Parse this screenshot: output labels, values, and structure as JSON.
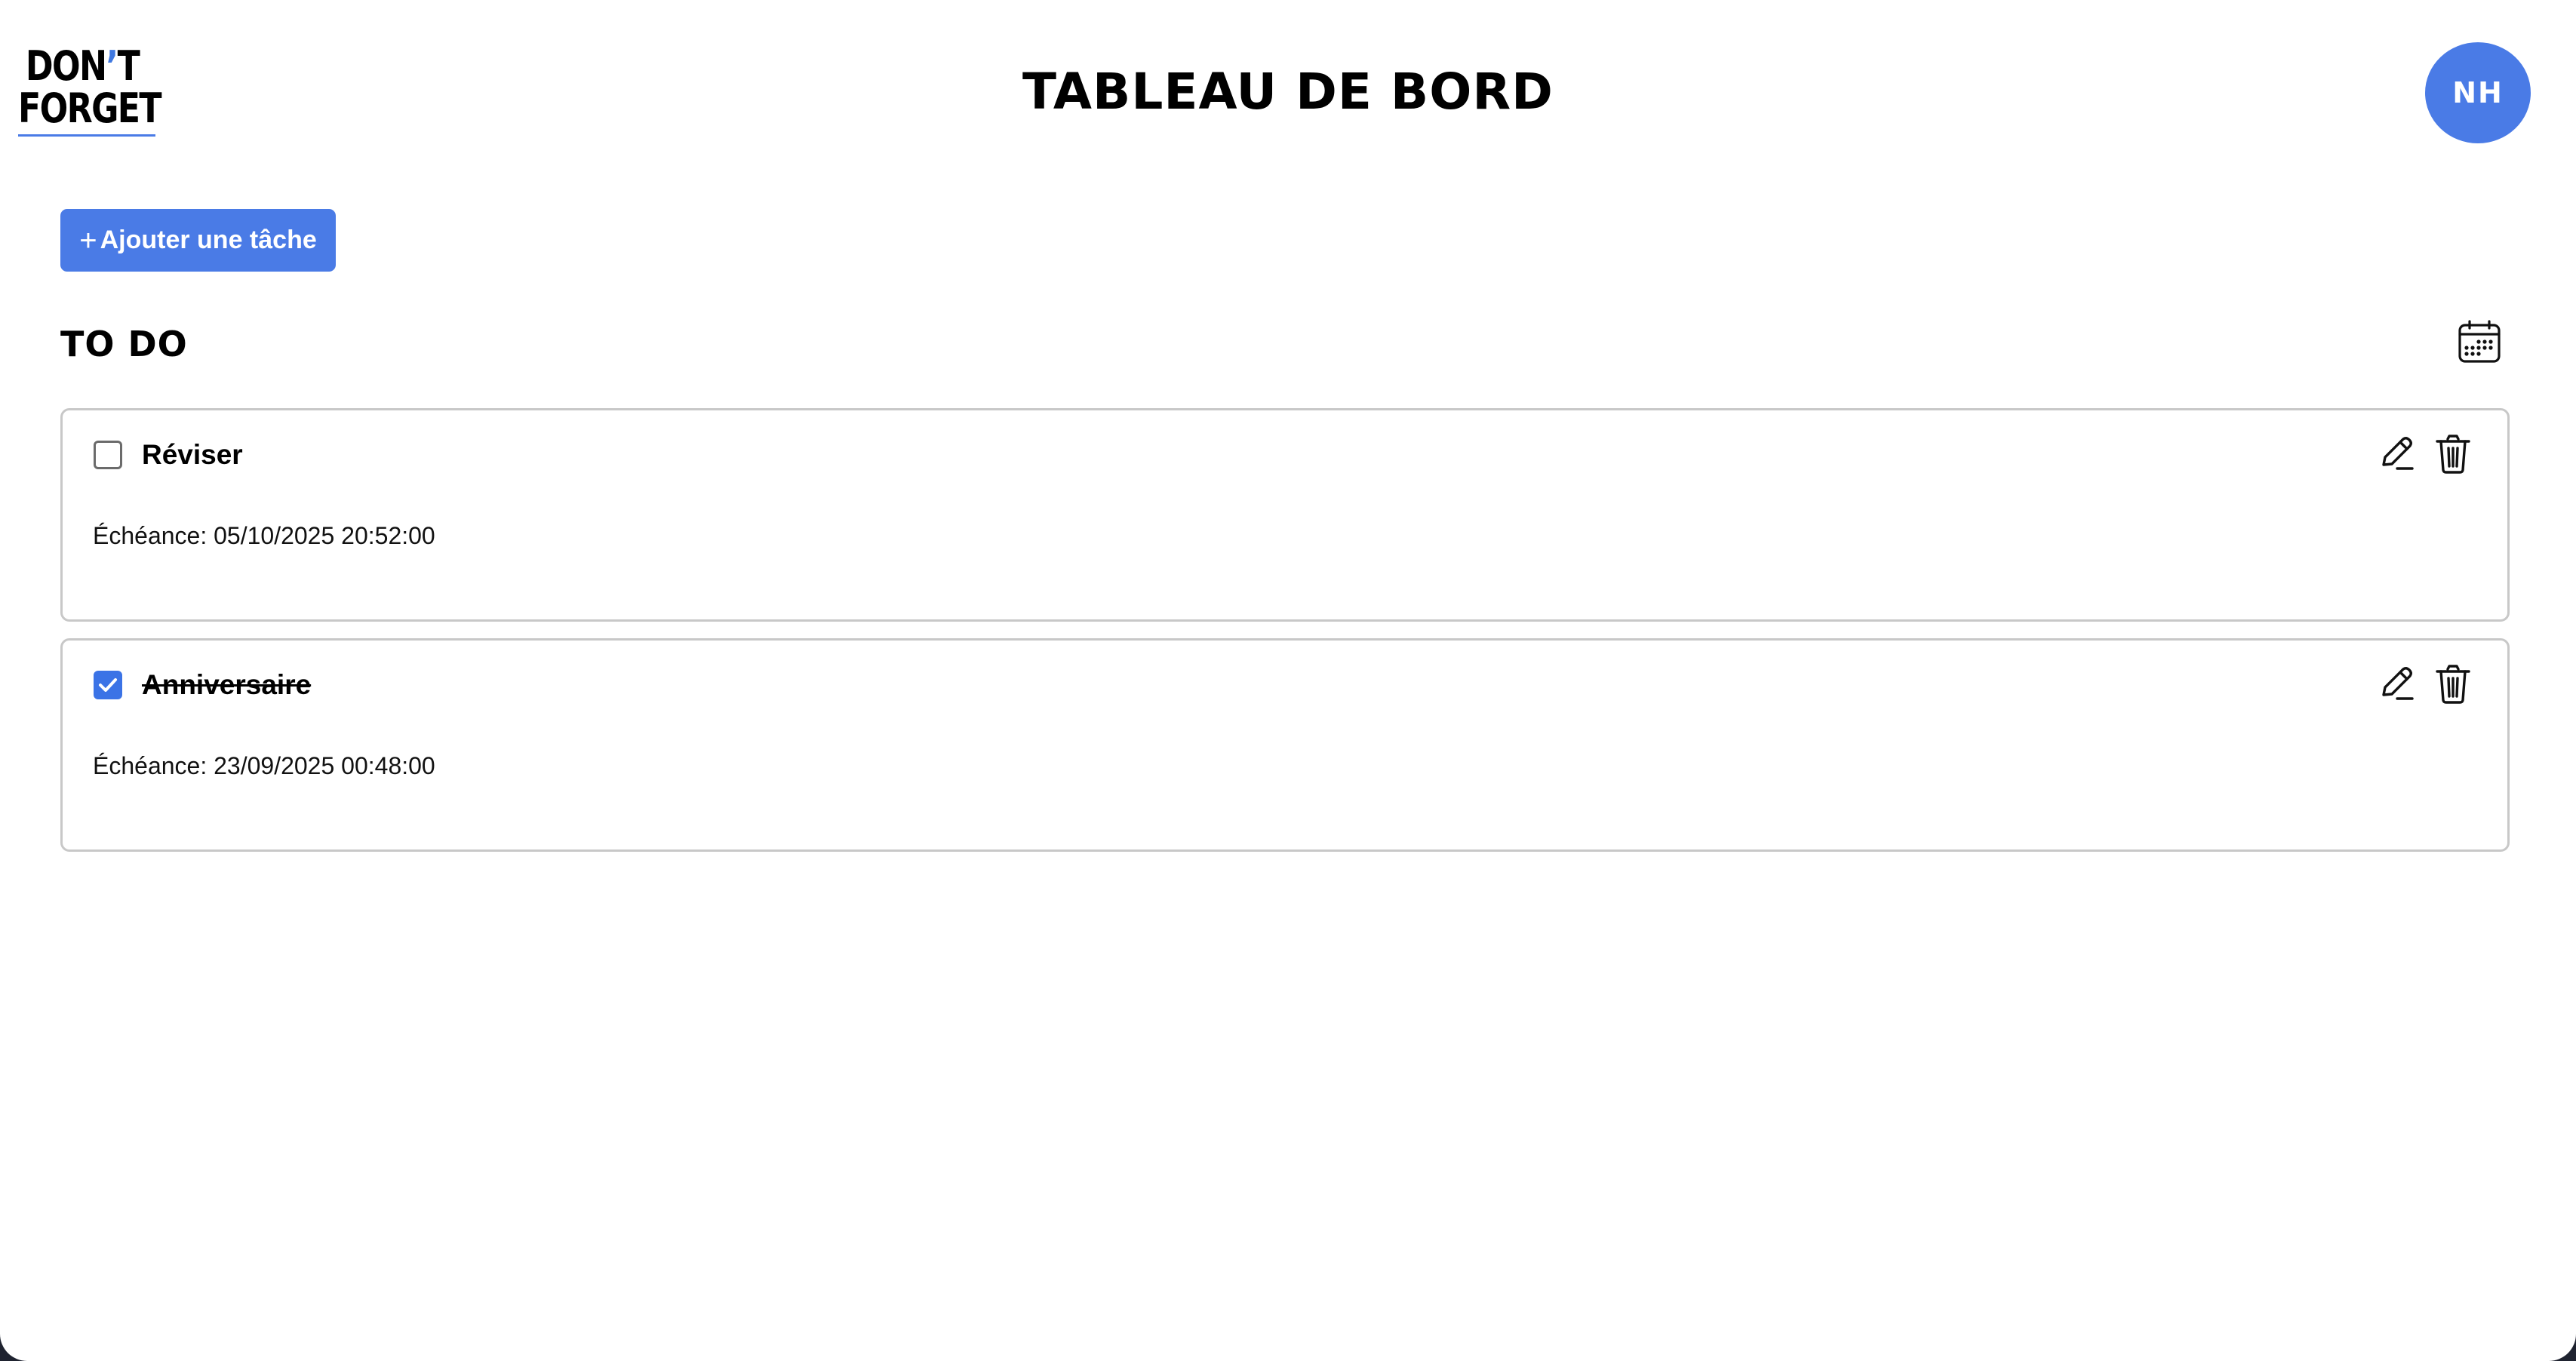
{
  "logo": {
    "line1_a": "DON",
    "line1_apos": "’",
    "line1_b": "T",
    "line2": "FORGET"
  },
  "header": {
    "title": "TABLEAU DE BORD",
    "avatar_initials": "NH"
  },
  "toolbar": {
    "add_icon": "+",
    "add_label": "Ajouter une tâche"
  },
  "section": {
    "title": "TO DO",
    "calendar_icon": "calendar-icon"
  },
  "tasks": [
    {
      "title": "Réviser",
      "completed": false,
      "due": "Échéance: 05/10/2025 20:52:00"
    },
    {
      "title": "Anniversaire",
      "completed": true,
      "due": "Échéance: 23/09/2025 00:48:00"
    }
  ],
  "colors": {
    "accent": "#4a7be6",
    "checkbox_checked": "#3b73e6",
    "card_border": "#c8c8c8"
  }
}
